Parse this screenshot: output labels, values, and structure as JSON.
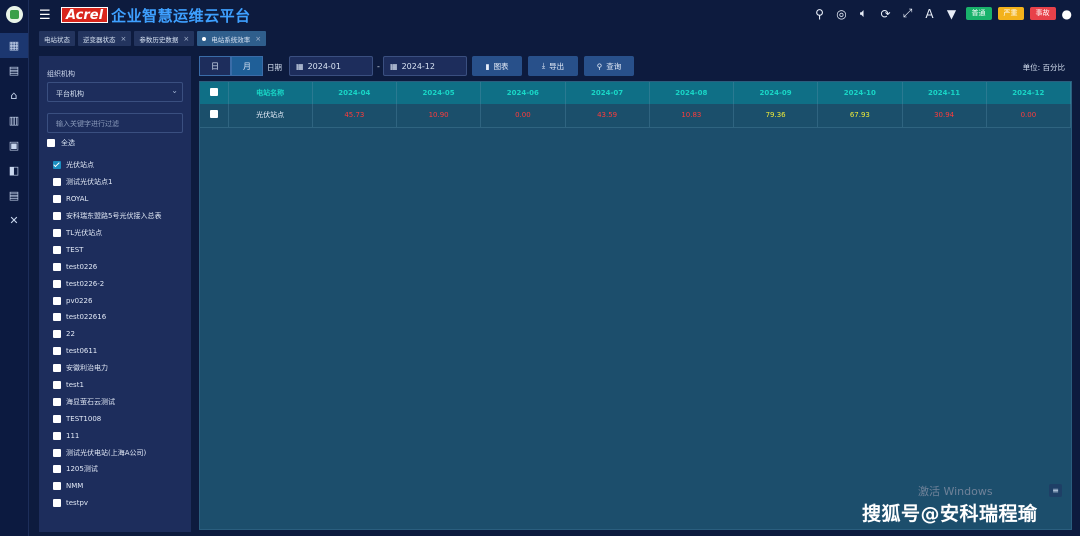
{
  "app": {
    "brand": "Acrel",
    "title": "企业智慧运维云平台"
  },
  "status_badges": [
    {
      "label": "普通",
      "color": "#19b26b"
    },
    {
      "label": "严重",
      "color": "#f3b21b"
    },
    {
      "label": "事故",
      "color": "#e8414a"
    }
  ],
  "toolbar_icons": [
    "search-icon",
    "target-icon",
    "volume-icon",
    "refresh-icon",
    "fullscreen-icon",
    "font-icon",
    "theme-icon"
  ],
  "tabs": [
    {
      "label": "电站状态",
      "active": false
    },
    {
      "label": "逆变器状态",
      "active": false
    },
    {
      "label": "参数历史数据",
      "active": false
    },
    {
      "label": "电站系统效率",
      "active": true
    }
  ],
  "left_nav": [
    "dashboard-icon",
    "document-icon",
    "pole-icon",
    "grid-icon",
    "monitor-icon",
    "cube-icon",
    "report-icon",
    "tools-icon"
  ],
  "filter_panel": {
    "org_label": "组织机构",
    "org_value": "平台机构",
    "filter_placeholder": "输入关键字进行过滤",
    "select_all": "全选",
    "stations": [
      {
        "name": "光伏站点",
        "checked": true
      },
      {
        "name": "测试光伏站点1",
        "checked": false
      },
      {
        "name": "ROYAL",
        "checked": false
      },
      {
        "name": "安科瑞东盟路5号光伏接入总表",
        "checked": false
      },
      {
        "name": "TL光伏站点",
        "checked": false
      },
      {
        "name": "TEST",
        "checked": false
      },
      {
        "name": "test0226",
        "checked": false
      },
      {
        "name": "test0226-2",
        "checked": false
      },
      {
        "name": "pv0226",
        "checked": false
      },
      {
        "name": "test022616",
        "checked": false
      },
      {
        "name": "22",
        "checked": false
      },
      {
        "name": "test0611",
        "checked": false
      },
      {
        "name": "安徽利治电力",
        "checked": false
      },
      {
        "name": "test1",
        "checked": false
      },
      {
        "name": "海显萤石云测试",
        "checked": false
      },
      {
        "name": "TEST1008",
        "checked": false
      },
      {
        "name": "111",
        "checked": false
      },
      {
        "name": "测试光伏电站(上海A公司)",
        "checked": false
      },
      {
        "name": "1205测试",
        "checked": false
      },
      {
        "name": "NMM",
        "checked": false
      },
      {
        "name": "testpv",
        "checked": false
      }
    ]
  },
  "query": {
    "day_label": "日",
    "month_label": "月",
    "date_label": "日期",
    "start": "2024-01",
    "separator": "-",
    "end": "2024-12",
    "chart_btn": "图表",
    "export_btn": "导出",
    "query_btn": "查询",
    "unit": "单位: 百分比"
  },
  "table": {
    "name_header": "电站名称",
    "months": [
      "2024-04",
      "2024-05",
      "2024-06",
      "2024-07",
      "2024-08",
      "2024-09",
      "2024-10",
      "2024-11",
      "2024-12"
    ],
    "rows": [
      {
        "name": "光伏站点",
        "values": [
          "45.73",
          "10.90",
          "0.00",
          "43.59",
          "10.83",
          "79.36",
          "67.93",
          "30.94",
          "0.00"
        ],
        "colors": [
          "red",
          "red",
          "red",
          "red",
          "red",
          "yellow",
          "yellow",
          "red",
          "red"
        ]
      }
    ]
  },
  "watermark": {
    "line1": "激活 Windows",
    "line2": "搜狐号@安科瑞程瑜"
  }
}
